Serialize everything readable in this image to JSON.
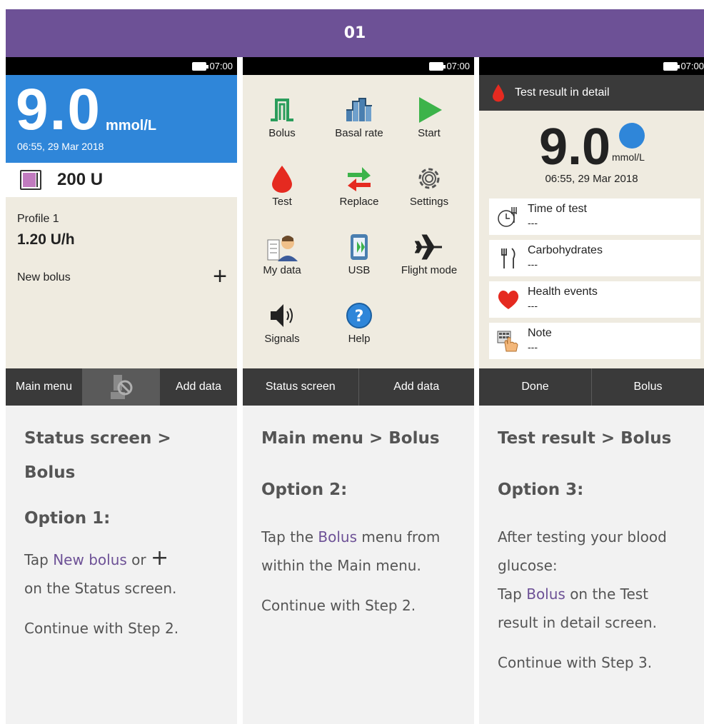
{
  "header": {
    "title": "01"
  },
  "status_bar": {
    "time": "07:00"
  },
  "screen1": {
    "glucose_value": "9.0",
    "glucose_unit": "mmol/L",
    "datetime": "06:55, 29 Mar 2018",
    "insulin_units": "200 U",
    "profile": "Profile 1",
    "basal_rate": "1.20 U/h",
    "new_bolus": "New bolus",
    "plus": "+",
    "bottom": {
      "left": "Main menu",
      "right": "Add data"
    }
  },
  "screen2": {
    "menu": [
      {
        "label": "Bolus"
      },
      {
        "label": "Basal rate"
      },
      {
        "label": "Start"
      },
      {
        "label": "Test"
      },
      {
        "label": "Replace"
      },
      {
        "label": "Settings"
      },
      {
        "label": "My data"
      },
      {
        "label": "USB"
      },
      {
        "label": "Flight mode"
      },
      {
        "label": "Signals"
      },
      {
        "label": "Help"
      }
    ],
    "bottom": {
      "left": "Status screen",
      "right": "Add data"
    }
  },
  "screen3": {
    "title": "Test result in detail",
    "glucose_value": "9.0",
    "glucose_unit": "mmol/L",
    "datetime": "06:55, 29 Mar 2018",
    "rows": [
      {
        "title": "Time of test",
        "value": "---"
      },
      {
        "title": "Carbohydrates",
        "value": "---"
      },
      {
        "title": "Health events",
        "value": "---"
      },
      {
        "title": "Note",
        "value": "---"
      }
    ],
    "bottom": {
      "left": "Done",
      "right": "Bolus"
    }
  },
  "instructions": {
    "col1": {
      "heading": "Status screen > Bolus",
      "option": "Option 1:",
      "tap": "Tap",
      "link": "New bolus",
      "or": "or",
      "plus": "+",
      "rest": "on the Status screen.",
      "continue": "Continue with Step 2."
    },
    "col2": {
      "heading": "Main menu > Bolus",
      "option": "Option 2:",
      "tap": "Tap the",
      "link": "Bolus",
      "rest": "menu from within the Main menu.",
      "continue": "Continue with Step 2."
    },
    "col3": {
      "heading": "Test result > Bolus",
      "option": "Option 3:",
      "line1": "After testing your blood glucose:",
      "tap": "Tap",
      "link": "Bolus",
      "rest": "on the Test result in detail screen.",
      "continue": "Continue with Step 3."
    }
  },
  "colors": {
    "header": "#6d5196",
    "link": "#6d5196",
    "blue": "#2f86d9",
    "screen_bg": "#efebe0",
    "bar": "#3a3a3a"
  }
}
